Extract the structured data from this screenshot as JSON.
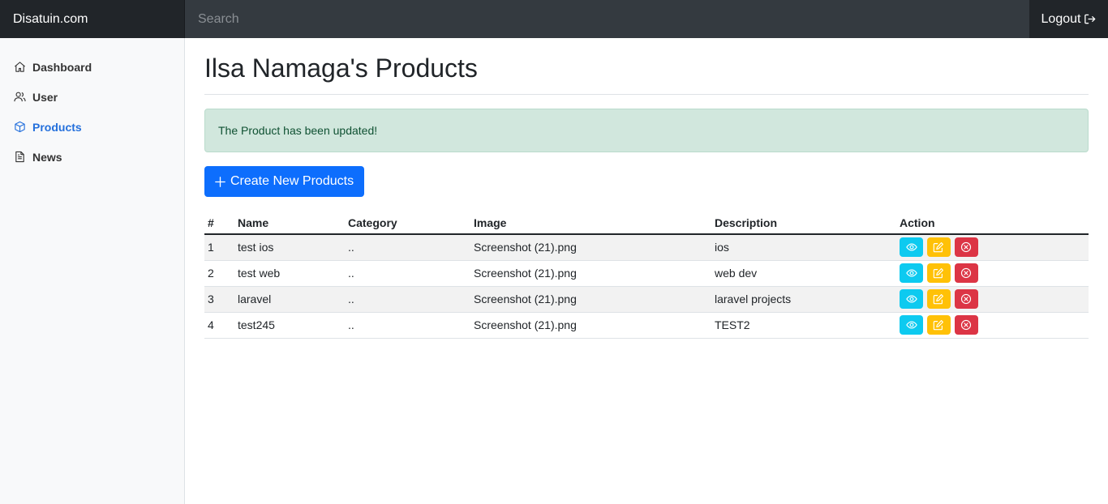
{
  "navbar": {
    "brand": "Disatuin.com",
    "search_placeholder": "Search",
    "logout_label": "Logout"
  },
  "sidebar": {
    "items": [
      {
        "label": "Dashboard",
        "icon": "home-icon"
      },
      {
        "label": "User",
        "icon": "users-icon"
      },
      {
        "label": "Products",
        "icon": "box-icon",
        "active": true
      },
      {
        "label": "News",
        "icon": "document-icon"
      }
    ]
  },
  "main": {
    "title": "Ilsa Namaga's Products",
    "alert": "The Product has been updated!",
    "create_button": "Create New Products"
  },
  "table": {
    "headers": [
      "#",
      "Name",
      "Category",
      "Image",
      "Description",
      "Action"
    ],
    "rows": [
      {
        "num": "1",
        "name": "test ios",
        "category": "..",
        "image": "Screenshot (21).png",
        "description": "ios"
      },
      {
        "num": "2",
        "name": "test web",
        "category": "..",
        "image": "Screenshot (21).png",
        "description": "web dev"
      },
      {
        "num": "3",
        "name": "laravel",
        "category": "..",
        "image": "Screenshot (21).png",
        "description": "laravel projects"
      },
      {
        "num": "4",
        "name": "test245",
        "category": "..",
        "image": "Screenshot (21).png",
        "description": "TEST2"
      }
    ]
  },
  "colors": {
    "navbar": "#343a40",
    "brand_bg": "#212529",
    "active_link": "#2470dc",
    "primary": "#0d6efd",
    "info": "#0dcaf0",
    "warning": "#ffc107",
    "danger": "#dc3545",
    "alert_bg": "#d1e7dd"
  }
}
